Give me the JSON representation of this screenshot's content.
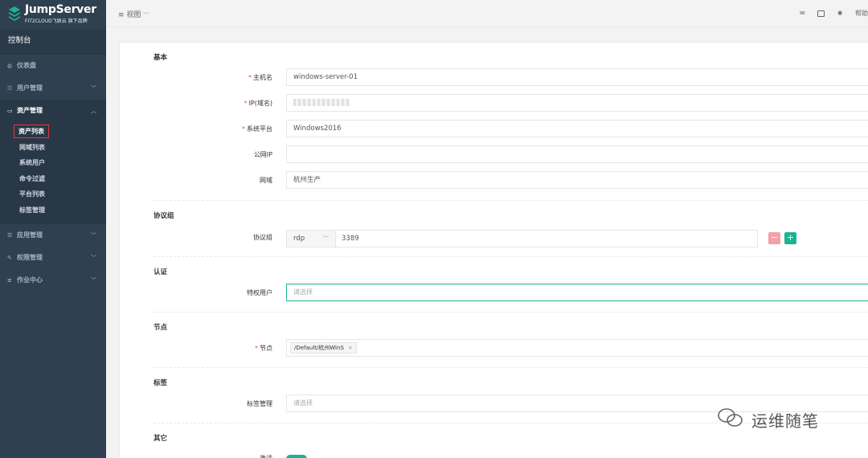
{
  "brand": {
    "title": "JumpServer",
    "subtitle": "FIT2CLOUD飞致云 旗下品牌"
  },
  "sidebar": {
    "console_label": "控制台",
    "items": [
      {
        "label": "仪表盘",
        "icon": "dashboard-icon"
      },
      {
        "label": "用户管理",
        "icon": "users-icon"
      },
      {
        "label": "资产管理",
        "icon": "inbox-icon"
      },
      {
        "label": "应用管理",
        "icon": "grid-icon"
      },
      {
        "label": "权限管理",
        "icon": "edit-icon"
      },
      {
        "label": "作业中心",
        "icon": "list-icon"
      }
    ],
    "asset_sub_items": [
      "资产列表",
      "网域列表",
      "系统用户",
      "命令过滤",
      "平台列表",
      "标签管理"
    ]
  },
  "topbar": {
    "view_label": "视图",
    "help_label": "帮助"
  },
  "form": {
    "sections": {
      "basic": "基本",
      "protocols": "协议组",
      "auth": "认证",
      "node": "节点",
      "labels": "标签",
      "other": "其它"
    },
    "hostname": {
      "label": "主机名",
      "value": "windows-server-01"
    },
    "ip": {
      "label": "IP(域名)"
    },
    "platform": {
      "label": "系统平台",
      "value": "Windows2016"
    },
    "public_ip": {
      "label": "公网IP",
      "value": ""
    },
    "domain": {
      "label": "网域",
      "value": "杭州生产"
    },
    "protocol_group": {
      "label": "协议组",
      "protocol": "rdp",
      "port": "3389"
    },
    "admin_user": {
      "label": "特权用户",
      "placeholder": "请选择"
    },
    "nodes": {
      "label": "节点",
      "tag": "/Default/杭州WinS"
    },
    "tag_manage": {
      "label": "标签管理",
      "placeholder": "请选择"
    },
    "active": {
      "label": "激活"
    }
  },
  "watermark": "运维随笔",
  "colors": {
    "sidebar": "#2f4050",
    "accent": "#1ab394",
    "required": "#ed5565"
  }
}
